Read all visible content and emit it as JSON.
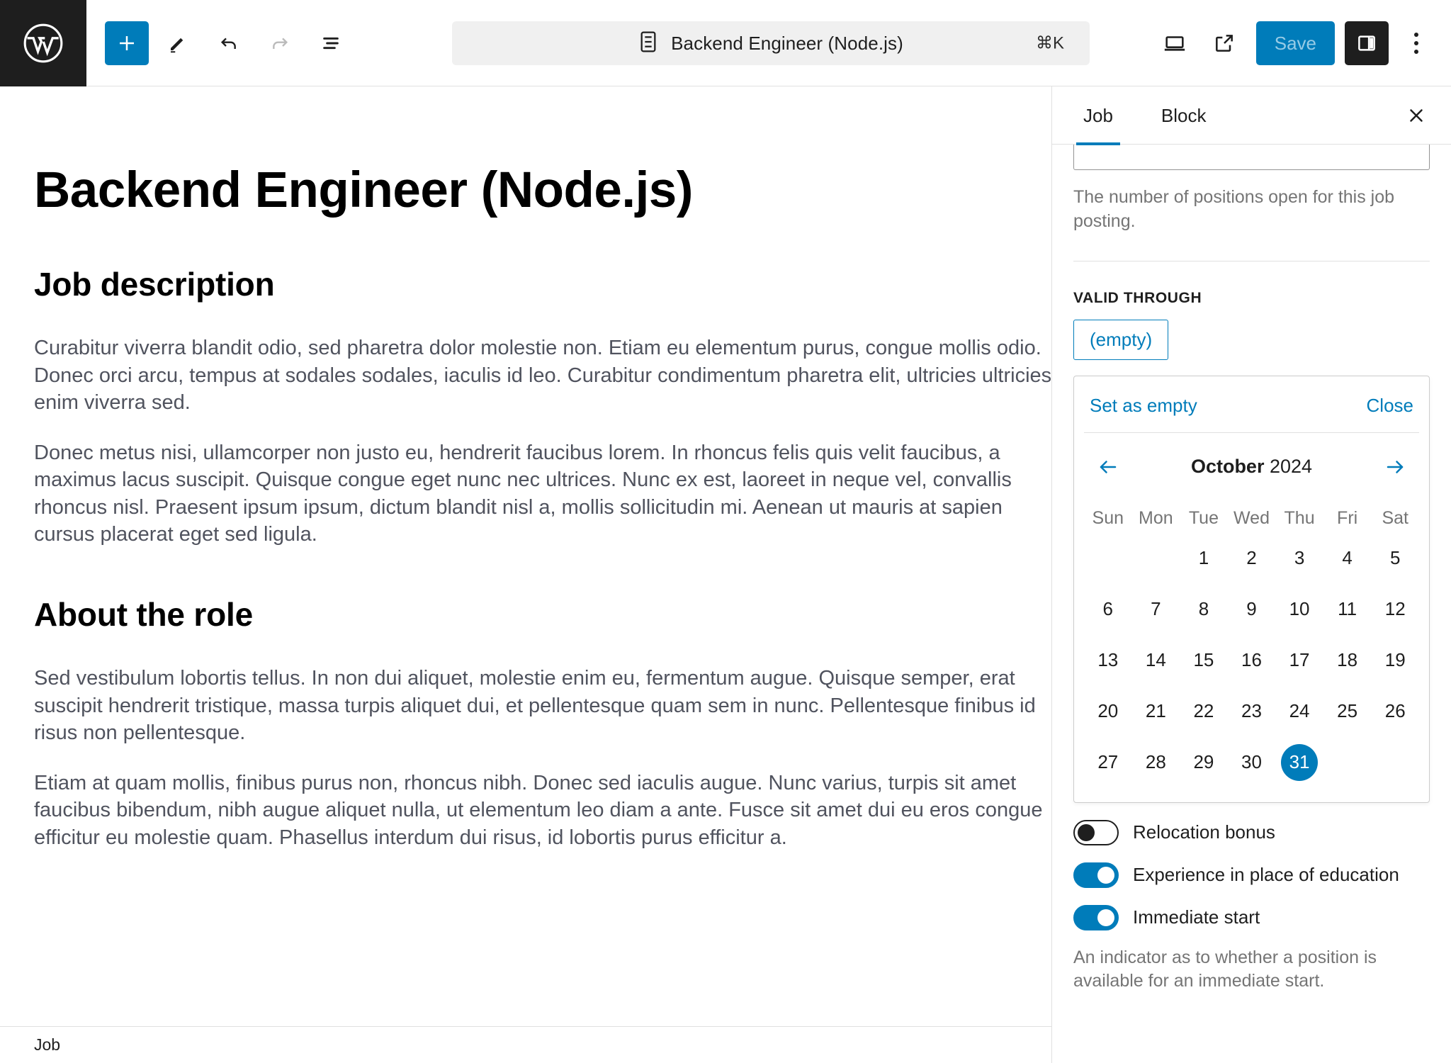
{
  "toolbar": {
    "logo_icon": "wordpress-logo-icon",
    "add_block_label": "+",
    "tools_icon": "pencil-edit-icon",
    "undo_icon": "undo-arrow-icon",
    "redo_icon": "redo-arrow-icon",
    "list_view_icon": "document-overview-icon",
    "preview_icon": "laptop-preview-icon",
    "external_icon": "view-external-link-icon",
    "save_label": "Save",
    "sidebar_toggle_icon": "settings-sidebar-icon",
    "options_icon": "kebab-menu-icon",
    "accent_color": "#007cba",
    "save_text_color": "#96cbe6"
  },
  "document_pill": {
    "icon": "document-page-icon",
    "title": "Backend Engineer (Node.js)",
    "shortcut": "⌘K"
  },
  "editor": {
    "post_title": "Backend Engineer (Node.js)",
    "blocks": [
      {
        "type": "heading",
        "text": "Job description"
      },
      {
        "type": "paragraph",
        "text": "Curabitur viverra blandit odio, sed pharetra dolor molestie non. Etiam eu elementum purus, congue mollis odio. Donec orci arcu, tempus at sodales sodales, iaculis id leo. Curabitur condimentum pharetra elit, ultricies ultricies enim viverra sed."
      },
      {
        "type": "paragraph",
        "text": "Donec metus nisi, ullamcorper non justo eu, hendrerit faucibus lorem. In rhoncus felis quis velit faucibus, a maximus lacus suscipit. Quisque congue eget nunc nec ultrices. Nunc ex est, laoreet in neque vel, convallis rhoncus nisl. Praesent ipsum ipsum, dictum blandit nisl a, mollis sollicitudin mi. Aenean ut mauris at sapien cursus placerat eget sed ligula."
      },
      {
        "type": "heading",
        "text": "About the role"
      },
      {
        "type": "paragraph",
        "text": "Sed vestibulum lobortis tellus. In non dui aliquet, molestie enim eu, fermentum augue. Quisque semper, erat suscipit hendrerit tristique, massa turpis aliquet dui, et pellentesque quam sem in nunc. Pellentesque finibus id risus non pellentesque."
      },
      {
        "type": "paragraph",
        "text": "Etiam at quam mollis, finibus purus non, rhoncus nibh. Donec sed iaculis augue. Nunc varius, turpis sit amet faucibus bibendum, nibh augue aliquet nulla, ut elementum leo diam a ante. Fusce sit amet dui eu eros congue efficitur eu molestie quam. Phasellus interdum dui risus, id lobortis purus efficitur a."
      }
    ]
  },
  "statusbar": {
    "label": "Job"
  },
  "sidebar": {
    "tabs": [
      {
        "id": "job",
        "label": "Job",
        "active": true
      },
      {
        "id": "block",
        "label": "Block",
        "active": false
      }
    ],
    "close_icon": "close-x-icon",
    "openings_help": "The number of positions open for this job posting.",
    "valid_through_label": "VALID THROUGH",
    "valid_through_value": "(empty)",
    "datepicker": {
      "set_empty_label": "Set as empty",
      "close_label": "Close",
      "prev_icon": "arrow-left-icon",
      "next_icon": "arrow-right-icon",
      "month": "October",
      "year": "2024",
      "weekdays": [
        "Sun",
        "Mon",
        "Tue",
        "Wed",
        "Thu",
        "Fri",
        "Sat"
      ],
      "leading_blanks": 2,
      "days": [
        1,
        2,
        3,
        4,
        5,
        6,
        7,
        8,
        9,
        10,
        11,
        12,
        13,
        14,
        15,
        16,
        17,
        18,
        19,
        20,
        21,
        22,
        23,
        24,
        25,
        26,
        27,
        28,
        29,
        30,
        31
      ],
      "selected_day": 31,
      "selected_color": "#007cba"
    },
    "toggles": [
      {
        "id": "relocation-bonus",
        "label": "Relocation bonus",
        "on": false
      },
      {
        "id": "experience-in-place-of-education",
        "label": "Experience in place of education",
        "on": true
      },
      {
        "id": "immediate-start",
        "label": "Immediate start",
        "on": true
      }
    ],
    "immediate_start_help": "An indicator as to whether a position is available for an immediate start."
  }
}
